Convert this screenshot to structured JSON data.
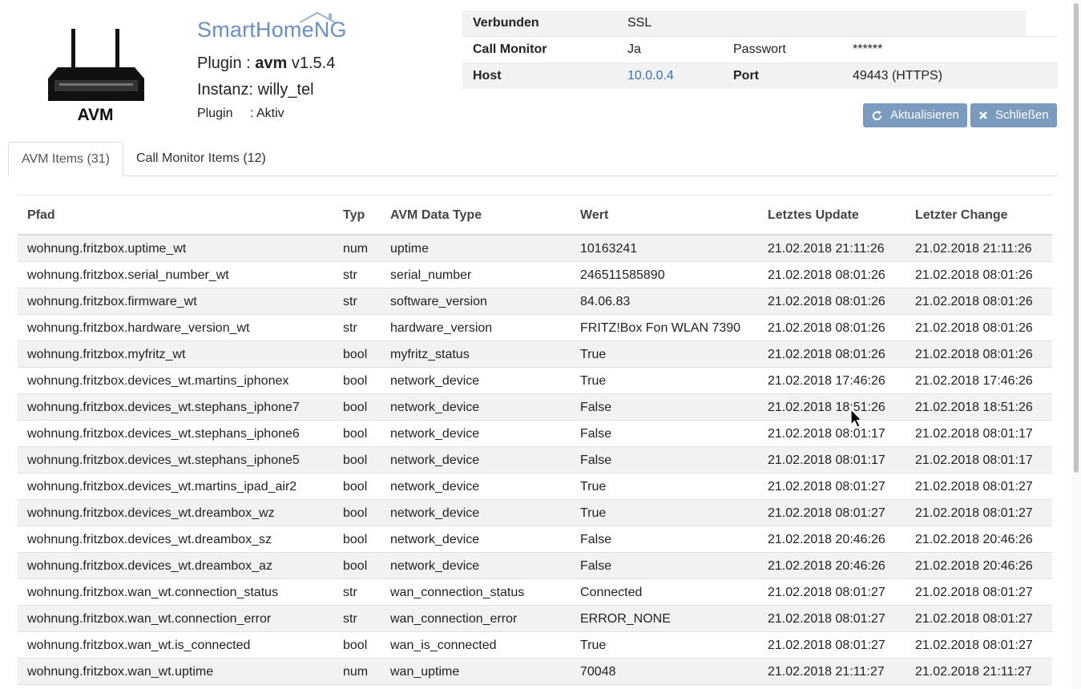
{
  "header": {
    "device_caption": "AVM",
    "brand_logo_text": "SmartHomeNG",
    "plugin_label": "Plugin : ",
    "plugin_name": "avm",
    "plugin_version": " v1.5.4",
    "instance_text": "Instanz: willy_tel",
    "plugin_state_label": "Plugin",
    "plugin_state_value": ": Aktiv"
  },
  "info": {
    "row1": {
      "label": "Verbunden",
      "value": "SSL"
    },
    "row2": {
      "label": "Call Monitor",
      "value": "Ja",
      "label2": "Passwort",
      "value2": "******"
    },
    "row3": {
      "label": "Host",
      "value": "10.0.0.4",
      "label2": "Port",
      "value2": "49443 (HTTPS)"
    }
  },
  "buttons": {
    "refresh": "Aktualisieren",
    "close": "Schließen"
  },
  "tabs": {
    "avm_items": "AVM Items (31)",
    "call_monitor_items": "Call Monitor Items (12)"
  },
  "table": {
    "headers": {
      "path": "Pfad",
      "type": "Typ",
      "avm_type": "AVM Data Type",
      "value": "Wert",
      "last_update": "Letztes Update",
      "last_change": "Letzter Change"
    },
    "rows": [
      [
        "wohnung.fritzbox.uptime_wt",
        "num",
        "uptime",
        "10163241",
        "21.02.2018 21:11:26",
        "21.02.2018 21:11:26"
      ],
      [
        "wohnung.fritzbox.serial_number_wt",
        "str",
        "serial_number",
        "246511585890",
        "21.02.2018 08:01:26",
        "21.02.2018 08:01:26"
      ],
      [
        "wohnung.fritzbox.firmware_wt",
        "str",
        "software_version",
        "84.06.83",
        "21.02.2018 08:01:26",
        "21.02.2018 08:01:26"
      ],
      [
        "wohnung.fritzbox.hardware_version_wt",
        "str",
        "hardware_version",
        "FRITZ!Box Fon WLAN 7390",
        "21.02.2018 08:01:26",
        "21.02.2018 08:01:26"
      ],
      [
        "wohnung.fritzbox.myfritz_wt",
        "bool",
        "myfritz_status",
        "True",
        "21.02.2018 08:01:26",
        "21.02.2018 08:01:26"
      ],
      [
        "wohnung.fritzbox.devices_wt.martins_iphonex",
        "bool",
        "network_device",
        "True",
        "21.02.2018 17:46:26",
        "21.02.2018 17:46:26"
      ],
      [
        "wohnung.fritzbox.devices_wt.stephans_iphone7",
        "bool",
        "network_device",
        "False",
        "21.02.2018 18:51:26",
        "21.02.2018 18:51:26"
      ],
      [
        "wohnung.fritzbox.devices_wt.stephans_iphone6",
        "bool",
        "network_device",
        "False",
        "21.02.2018 08:01:17",
        "21.02.2018 08:01:17"
      ],
      [
        "wohnung.fritzbox.devices_wt.stephans_iphone5",
        "bool",
        "network_device",
        "False",
        "21.02.2018 08:01:17",
        "21.02.2018 08:01:17"
      ],
      [
        "wohnung.fritzbox.devices_wt.martins_ipad_air2",
        "bool",
        "network_device",
        "True",
        "21.02.2018 08:01:27",
        "21.02.2018 08:01:27"
      ],
      [
        "wohnung.fritzbox.devices_wt.dreambox_wz",
        "bool",
        "network_device",
        "True",
        "21.02.2018 08:01:27",
        "21.02.2018 08:01:27"
      ],
      [
        "wohnung.fritzbox.devices_wt.dreambox_sz",
        "bool",
        "network_device",
        "False",
        "21.02.2018 20:46:26",
        "21.02.2018 20:46:26"
      ],
      [
        "wohnung.fritzbox.devices_wt.dreambox_az",
        "bool",
        "network_device",
        "False",
        "21.02.2018 20:46:26",
        "21.02.2018 20:46:26"
      ],
      [
        "wohnung.fritzbox.wan_wt.connection_status",
        "str",
        "wan_connection_status",
        "Connected",
        "21.02.2018 08:01:27",
        "21.02.2018 08:01:27"
      ],
      [
        "wohnung.fritzbox.wan_wt.connection_error",
        "str",
        "wan_connection_error",
        "ERROR_NONE",
        "21.02.2018 08:01:27",
        "21.02.2018 08:01:27"
      ],
      [
        "wohnung.fritzbox.wan_wt.is_connected",
        "bool",
        "wan_is_connected",
        "True",
        "21.02.2018 08:01:27",
        "21.02.2018 08:01:27"
      ],
      [
        "wohnung.fritzbox.wan_wt.uptime",
        "num",
        "wan_uptime",
        "70048",
        "21.02.2018 21:11:27",
        "21.02.2018 21:11:27"
      ]
    ]
  },
  "colors": {
    "button_bg": "#7a9bbd",
    "link": "#3a6fb0",
    "row_stripe": "#f2f2f2"
  },
  "icons": {
    "refresh": "refresh-icon",
    "close": "close-icon",
    "device": "router-icon"
  }
}
